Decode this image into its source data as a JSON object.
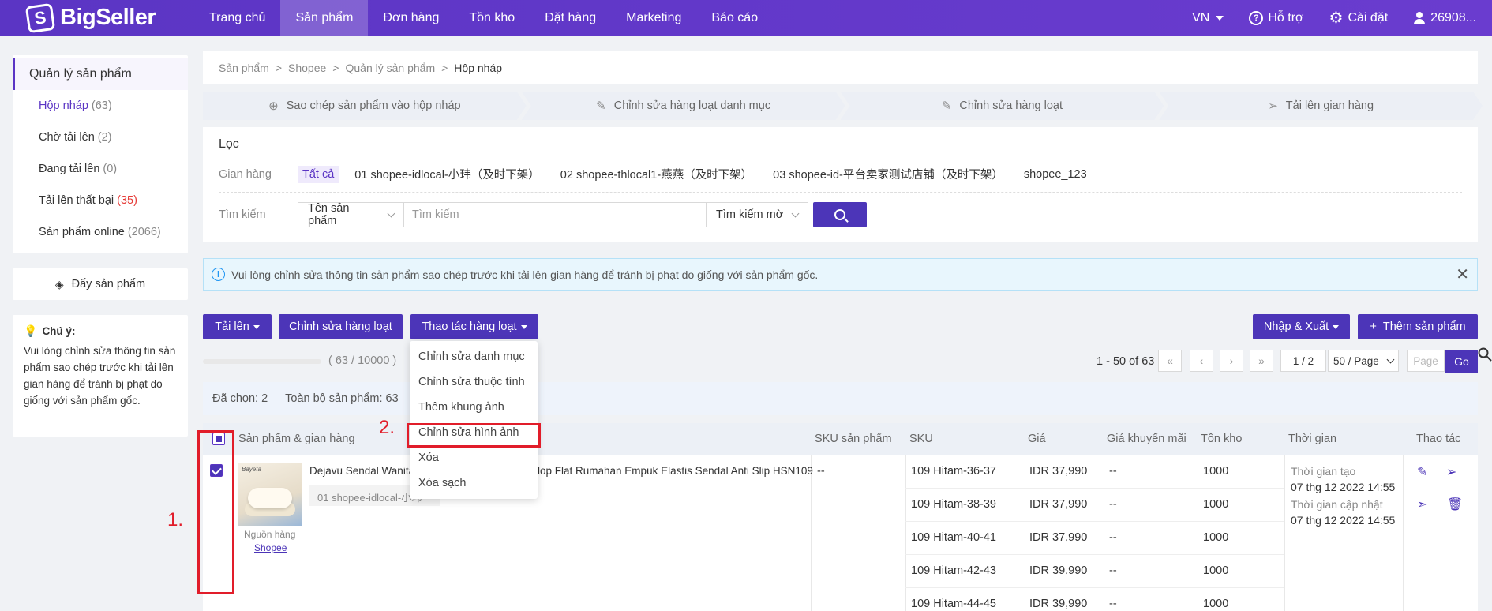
{
  "app": {
    "brand": "BigSeller"
  },
  "nav": {
    "items": [
      "Trang chủ",
      "Sản phẩm",
      "Đơn hàng",
      "Tồn kho",
      "Đặt hàng",
      "Marketing",
      "Báo cáo"
    ],
    "lang": "VN",
    "help": "Hỗ trợ",
    "settings": "Cài đặt",
    "user": "26908..."
  },
  "sidebar": {
    "heading": "Quản lý sản phẩm",
    "items": [
      {
        "label": "Hộp nháp",
        "count": "(63)"
      },
      {
        "label": "Chờ tải lên",
        "count": "(2)"
      },
      {
        "label": "Đang tải lên",
        "count": "(0)"
      },
      {
        "label": "Tải lên thất bại",
        "count": "(35)"
      },
      {
        "label": "Sản phẩm online",
        "count": "(2066)"
      }
    ],
    "push": "Đẩy sản phẩm",
    "note_title": "Chú ý:",
    "note_body": "Vui lòng chỉnh sửa thông tin sản phẩm sao chép trước khi tải lên gian hàng để tránh bị phạt do giống với sản phẩm gốc."
  },
  "breadcrumb": [
    "Sản phẩm",
    "Shopee",
    "Quản lý sản phẩm",
    "Hộp nháp"
  ],
  "steps": [
    "Sao chép sản phẩm vào hộp nháp",
    "Chỉnh sửa hàng loạt danh mục",
    "Chỉnh sửa hàng loạt",
    "Tải lên gian hàng"
  ],
  "filter": {
    "title": "Lọc",
    "store_label": "Gian hàng",
    "stores": [
      "Tất cả",
      "01 shopee-idlocal-小玮（及时下架）",
      "02 shopee-thlocal1-燕燕（及时下架）",
      "03 shopee-id-平台卖家测试店铺（及时下架）",
      "shopee_123"
    ],
    "search_label": "Tìm kiếm",
    "search_field": "Tên sản phẩm",
    "search_placeholder": "Tìm kiếm",
    "search_mode": "Tìm kiếm mờ"
  },
  "alert": {
    "text": "Vui lòng chỉnh sửa thông tin sản phẩm sao chép trước khi tải lên gian hàng để tránh bị phạt do giống với sản phẩm gốc."
  },
  "toolbar": {
    "upload": "Tải lên",
    "bulk_edit": "Chỉnh sửa hàng loạt",
    "bulk_action": "Thao tác hàng loạt",
    "import_export": "Nhập & Xuất",
    "add_product": "Thêm sản phẩm"
  },
  "quota": {
    "text": "( 63 / 10000 )",
    "fraction": 0.0063
  },
  "pagination": {
    "range": "1 - 50 of 63",
    "page": "1 / 2",
    "per_page": "50 / Page",
    "page_placeholder": "Page",
    "go": "Go"
  },
  "selection": {
    "selected": "Đã chọn: 2",
    "total": "Toàn bộ sản phẩm: 63"
  },
  "dropdown": {
    "items": [
      "Chỉnh sửa danh mục",
      "Chỉnh sửa thuộc tính",
      "Thêm khung ảnh",
      "Chỉnh sửa hình ảnh",
      "Xóa",
      "Xóa sạch"
    ]
  },
  "table": {
    "headers": [
      "Sản phẩm & gian hàng",
      "SKU sản phẩm",
      "SKU",
      "Giá",
      "Giá khuyến mãi",
      "Tồn kho",
      "Thời gian",
      "Thao tác"
    ],
    "row": {
      "title_left": "Dejavu Sendal Wanita",
      "title_right": "lop Flat Rumahan Empuk Elastis Sendal Anti Slip HSN109",
      "store": "01 shopee-idlocal-小玮",
      "source_label": "Nguồn hàng",
      "source_link": "Shopee",
      "thumb_badge": "Bayeta",
      "product_sku": "--",
      "time_created_label": "Thời gian tạo",
      "time_created": "07 thg 12 2022 14:55",
      "time_updated_label": "Thời gian cập nhật",
      "time_updated": "07 thg 12 2022 14:55",
      "variants": [
        {
          "sku": "109 Hitam-36-37",
          "price": "IDR 37,990",
          "promo": "--",
          "stock": "1000"
        },
        {
          "sku": "109 Hitam-38-39",
          "price": "IDR 37,990",
          "promo": "--",
          "stock": "1000"
        },
        {
          "sku": "109 Hitam-40-41",
          "price": "IDR 37,990",
          "promo": "--",
          "stock": "1000"
        },
        {
          "sku": "109 Hitam-42-43",
          "price": "IDR 39,990",
          "promo": "--",
          "stock": "1000"
        },
        {
          "sku": "109 Hitam-44-45",
          "price": "IDR 39,990",
          "promo": "--",
          "stock": "1000"
        }
      ]
    }
  },
  "annotations": {
    "one": "1.",
    "two": "2."
  },
  "colors": {
    "brand": "#5b35c4",
    "button": "#4c35b8",
    "highlight": "#e11d2a",
    "danger_count": "#e53935"
  }
}
